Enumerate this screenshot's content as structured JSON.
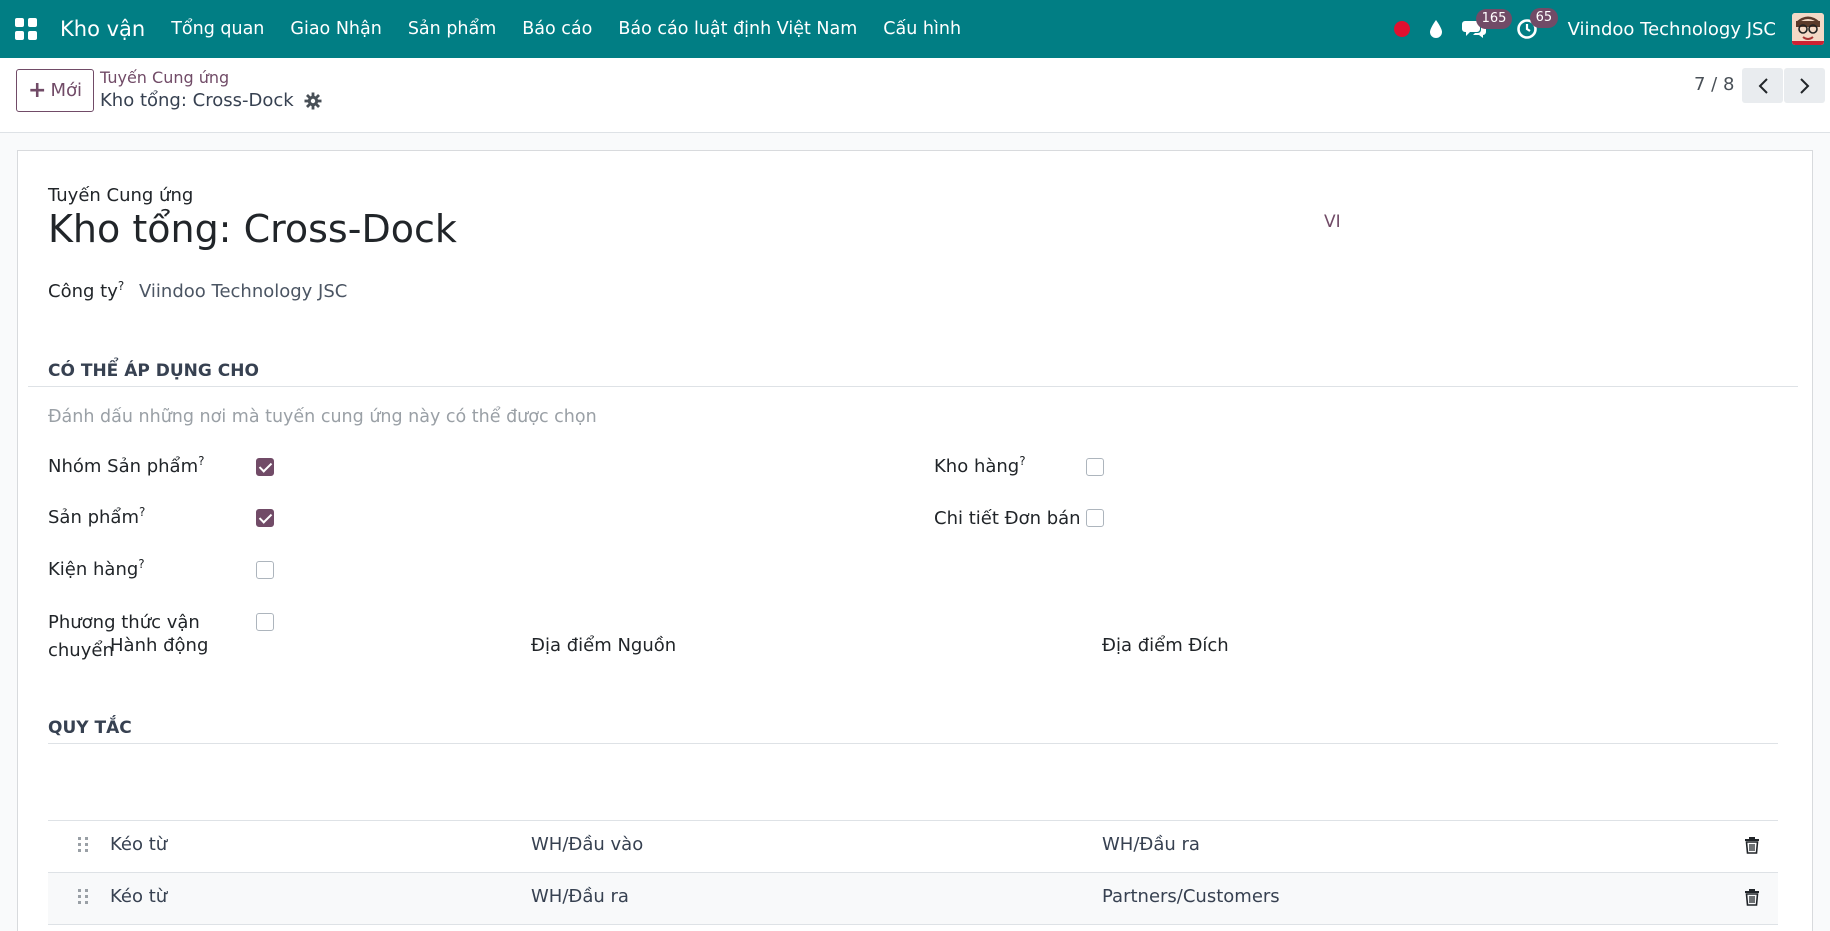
{
  "navbar": {
    "brand": "Kho vận",
    "menu": [
      {
        "label": "Tổng quan"
      },
      {
        "label": "Giao Nhận"
      },
      {
        "label": "Sản phẩm"
      },
      {
        "label": "Báo cáo"
      },
      {
        "label": "Báo cáo luật định Việt Nam"
      },
      {
        "label": "Cấu hình"
      }
    ],
    "messages_count": "165",
    "activities_count": "65",
    "company": "Viindoo Technology JSC"
  },
  "control_panel": {
    "new_label": "Mới",
    "breadcrumb_parent": "Tuyến Cung ứng",
    "breadcrumb_current": "Kho tổng: Cross-Dock",
    "pager": "7 / 8"
  },
  "form": {
    "record_label": "Tuyến Cung ứng",
    "record_title": "Kho tổng: Cross-Dock",
    "lang": "VI",
    "company_label": "Công ty",
    "company_value": "Viindoo Technology JSC",
    "applicable_section": "CÓ THỂ ÁP DỤNG CHO",
    "applicable_hint": "Đánh dấu những nơi mà tuyến cung ứng này có thể được chọn",
    "applicable": {
      "product_category": {
        "label": "Nhóm Sản phẩm",
        "checked": true
      },
      "product": {
        "label": "Sản phẩm",
        "checked": true
      },
      "packaging": {
        "label": "Kiện hàng",
        "checked": false
      },
      "shipping_method": {
        "label": "Phương thức vận chuyển",
        "checked": false
      },
      "warehouse": {
        "label": "Kho hàng",
        "checked": false
      },
      "sale_line": {
        "label": "Chi tiết Đơn bán",
        "checked": false
      }
    },
    "rules_section": "QUY TẮC",
    "rules_columns": [
      "Hành động",
      "Địa điểm Nguồn",
      "Địa điểm Đích"
    ],
    "rules": [
      {
        "action": "Kéo từ",
        "source": "WH/Đầu vào",
        "destination": "WH/Đầu ra"
      },
      {
        "action": "Kéo từ",
        "source": "WH/Đầu ra",
        "destination": "Partners/Customers"
      }
    ]
  },
  "colors": {
    "navbar": "#017e84",
    "primary": "#714b67",
    "record_dot": "#e0102f"
  }
}
